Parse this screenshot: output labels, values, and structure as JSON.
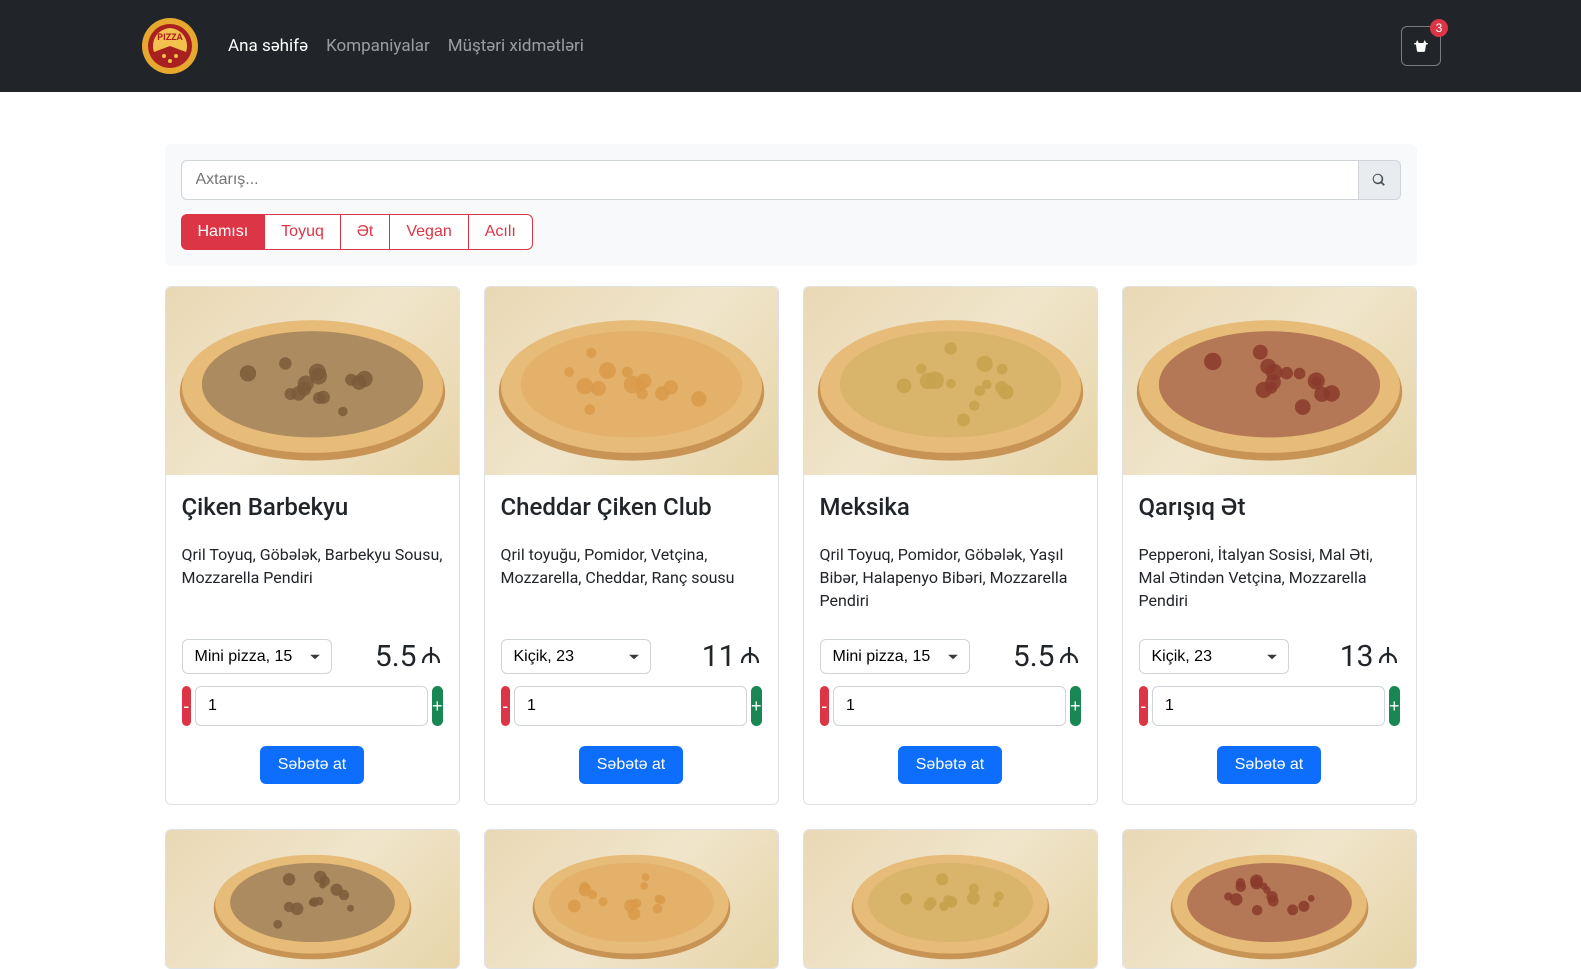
{
  "nav": {
    "home": "Ana səhifə",
    "companies": "Kompaniyalar",
    "support": "Müştəri xidmətləri",
    "cart_count": "3"
  },
  "search": {
    "placeholder": "Axtarış..."
  },
  "filters": [
    "Hamısı",
    "Toyuq",
    "Ət",
    "Vegan",
    "Acılı"
  ],
  "filter_active": 0,
  "add_to_cart_label": "Səbətə at",
  "products": [
    {
      "name": "Çiken Barbekyu",
      "desc": "Qril Toyuq, Göbələk, Barbekyu Sousu, Mozzarella Pendiri",
      "size": "Mini pizza, 15",
      "price": "5.5",
      "qty": "1",
      "topping": "#7a5a3a"
    },
    {
      "name": "Cheddar Çiken Club",
      "desc": "Qril toyuğu, Pomidor, Vetçina, Mozzarella, Cheddar, Ranç sousu",
      "size": "Kiçik, 23",
      "price": "11",
      "qty": "1",
      "topping": "#d99a4a"
    },
    {
      "name": "Meksika",
      "desc": "Qril Toyuq, Pomidor, Göbələk, Yaşıl Bibər, Halapenyo Bibəri, Mozzarella Pendiri",
      "size": "Mini pizza, 15",
      "price": "5.5",
      "qty": "1",
      "topping": "#c7a24e"
    },
    {
      "name": "Qarışıq Ət",
      "desc": "Pepperoni, İtalyan Sosisi, Mal Əti, Mal Ətindən Vetçina, Mozzarella Pendiri",
      "size": "Kiçik, 23",
      "price": "13",
      "qty": "1",
      "topping": "#8a3a2a"
    }
  ]
}
